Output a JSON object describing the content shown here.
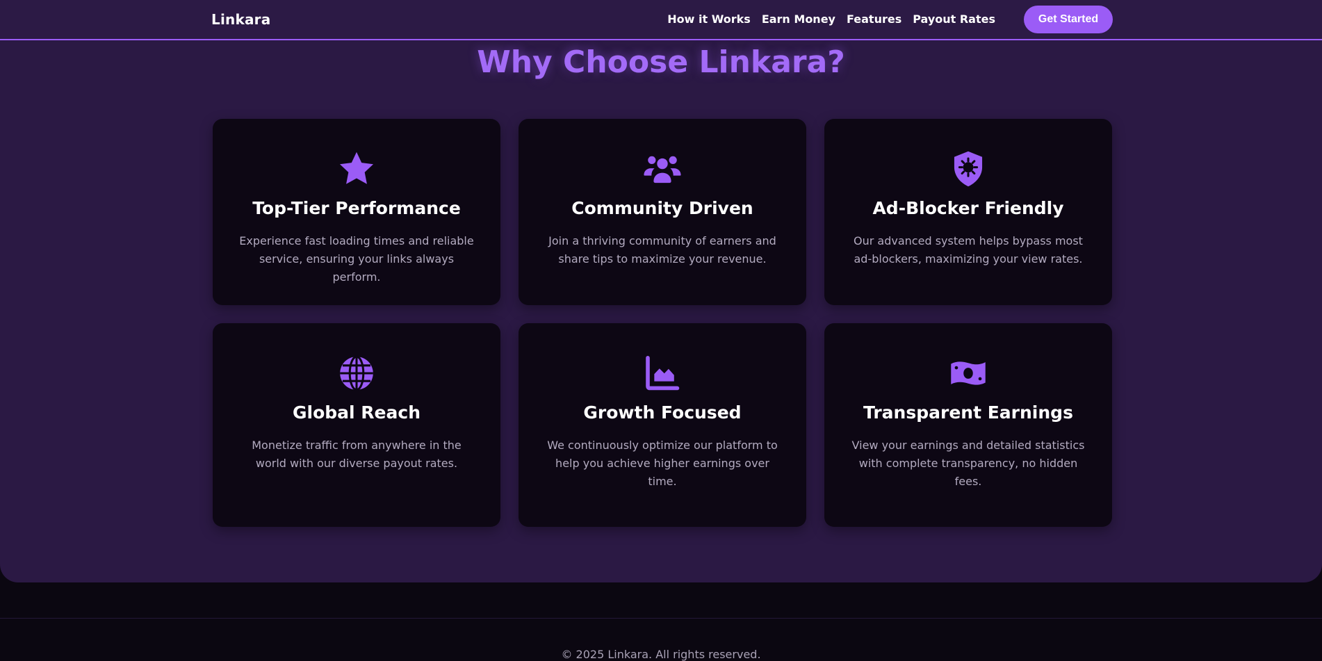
{
  "header": {
    "brand": "Linkara",
    "nav": [
      "How it Works",
      "Earn Money",
      "Features",
      "Payout Rates"
    ],
    "cta": "Get Started"
  },
  "section": {
    "title": "Why Choose Linkara?",
    "features": [
      {
        "icon": "star-icon",
        "title": "Top-Tier Performance",
        "desc": "Experience fast loading times and reliable service, ensuring your links always perform."
      },
      {
        "icon": "users-icon",
        "title": "Community Driven",
        "desc": "Join a thriving community of earners and share tips to maximize your revenue."
      },
      {
        "icon": "shield-virus-icon",
        "title": "Ad-Blocker Friendly",
        "desc": "Our advanced system helps bypass most ad-blockers, maximizing your view rates."
      },
      {
        "icon": "globe-icon",
        "title": "Global Reach",
        "desc": "Monetize traffic from anywhere in the world with our diverse payout rates."
      },
      {
        "icon": "chart-area-icon",
        "title": "Growth Focused",
        "desc": "We continuously optimize our platform to help you achieve higher earnings over time."
      },
      {
        "icon": "money-bill-icon",
        "title": "Transparent Earnings",
        "desc": "View your earnings and detailed statistics with complete transparency, no hidden fees."
      }
    ]
  },
  "footer": {
    "copyright": "© 2025 Linkara. All rights reserved."
  },
  "colors": {
    "accent": "#9b5cf6",
    "section_bg": "#2b1944",
    "card_bg": "#0d0714",
    "page_bg": "#0b0711"
  }
}
